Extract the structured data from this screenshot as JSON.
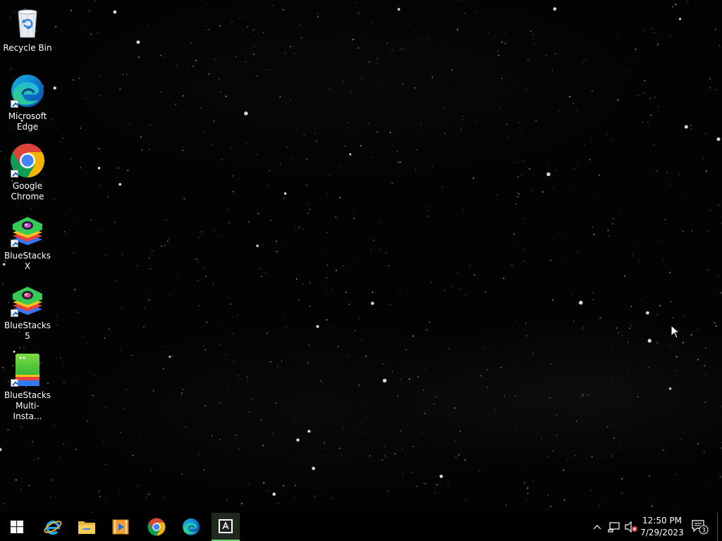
{
  "desktop": {
    "wallpaper": "starfield",
    "icons": [
      {
        "label": "Recycle Bin",
        "icon": "recycle-bin-icon"
      },
      {
        "label": "Microsoft\nEdge",
        "icon": "edge-icon"
      },
      {
        "label": "Google\nChrome",
        "icon": "chrome-icon"
      },
      {
        "label": "BlueStacks X",
        "icon": "bluestacks-x-icon"
      },
      {
        "label": "BlueStacks 5",
        "icon": "bluestacks-5-icon"
      },
      {
        "label": "BlueStacks\nMulti-Insta...",
        "icon": "bluestacks-multi-instance-icon"
      }
    ]
  },
  "taskbar": {
    "pinned": [
      {
        "name": "start",
        "icon": "windows-start-icon"
      },
      {
        "name": "internet-explorer",
        "icon": "internet-explorer-icon"
      },
      {
        "name": "file-explorer",
        "icon": "file-explorer-icon"
      },
      {
        "name": "media-player",
        "icon": "media-player-icon"
      },
      {
        "name": "google-chrome",
        "icon": "chrome-icon"
      },
      {
        "name": "microsoft-edge",
        "icon": "edge-icon"
      },
      {
        "name": "bluestacks-multi-instance",
        "icon": "bluestacks-multi-instance-icon",
        "active": true
      }
    ],
    "tray": {
      "time": "12:50 PM",
      "date": "7/29/2023",
      "notification_count": "3",
      "volume_state": "muted"
    }
  },
  "colors": {
    "taskbar_bg": "#000000",
    "active_app_highlight": "#6bd36b",
    "edge_blue": "#0c6fc7",
    "edge_green": "#33c481",
    "chrome_red": "#db4437",
    "chrome_yellow": "#f4b400",
    "chrome_green": "#0f9d58",
    "chrome_blue": "#4285f4"
  }
}
